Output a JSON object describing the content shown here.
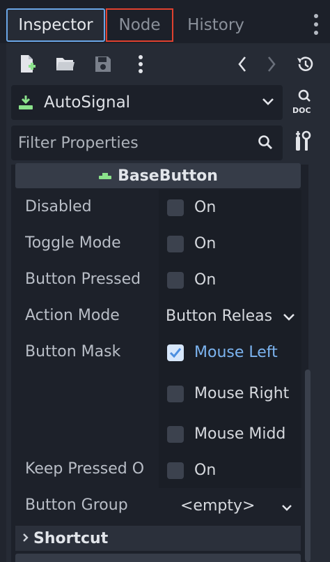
{
  "tabs": [
    {
      "label": "Inspector"
    },
    {
      "label": "Node"
    },
    {
      "label": "History"
    }
  ],
  "toolbar": {
    "icons": [
      "new-resource-icon",
      "open-folder-icon",
      "save-icon",
      "more-icon",
      "back-icon",
      "forward-icon",
      "history-icon"
    ]
  },
  "object_selector": {
    "label": "AutoSignal",
    "icon": "button-node-icon"
  },
  "doc_button": {
    "label": "DOC"
  },
  "filter": {
    "placeholder": "Filter Properties"
  },
  "section": {
    "title": "BaseButton"
  },
  "properties": {
    "disabled": {
      "label": "Disabled",
      "value": "On"
    },
    "toggle_mode": {
      "label": "Toggle Mode",
      "value": "On"
    },
    "button_pressed": {
      "label": "Button Pressed",
      "value": "On"
    },
    "action_mode": {
      "label": "Action Mode",
      "value": "Button Releas"
    },
    "button_mask": {
      "label": "Button Mask",
      "options": [
        {
          "label": "Mouse Left",
          "checked": true
        },
        {
          "label": "Mouse Right",
          "checked": false
        },
        {
          "label": "Mouse Midd",
          "checked": false
        }
      ]
    },
    "keep_pressed": {
      "label": "Keep Pressed O",
      "value": "On"
    },
    "button_group": {
      "label": "Button Group",
      "value": "<empty>"
    }
  },
  "shortcut": {
    "label": "Shortcut"
  },
  "colors": {
    "accent": "#6aa6e6",
    "node_tab_border": "#e0412f",
    "checked_text": "#7cb4f0",
    "node_icon": "#8be28b"
  }
}
